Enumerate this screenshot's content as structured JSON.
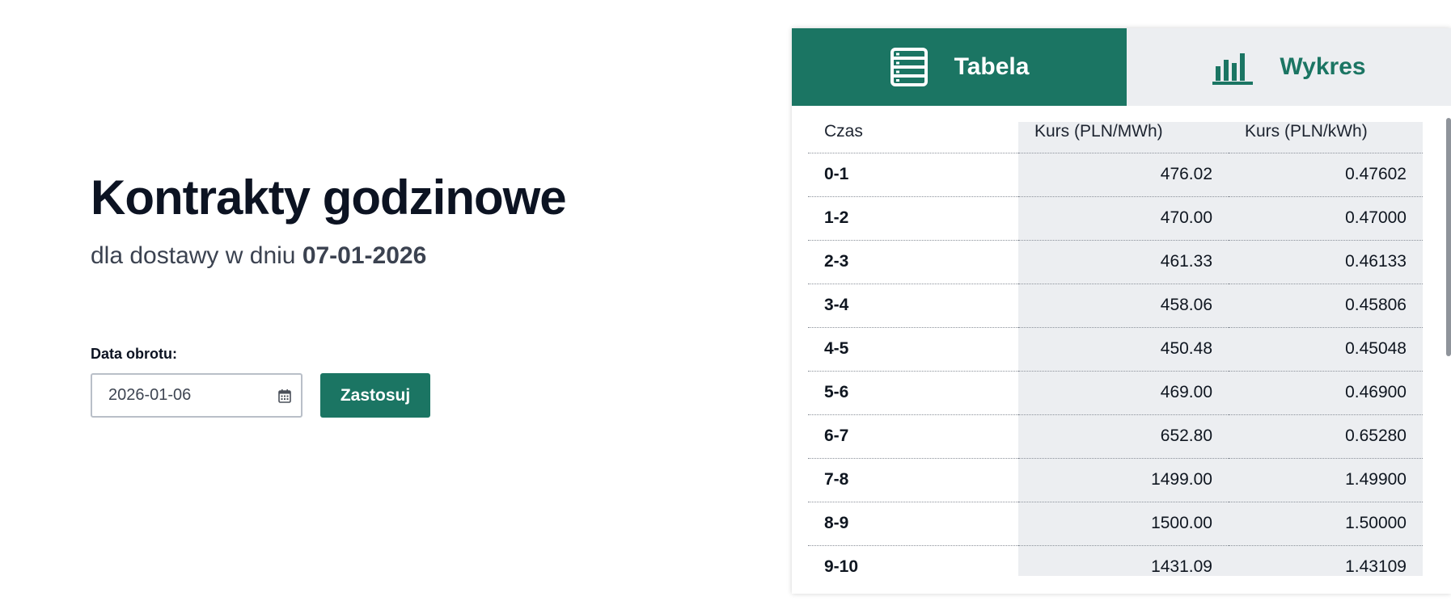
{
  "header": {
    "title": "Kontrakty godzinowe",
    "subtitle_prefix": "dla dostawy w dniu ",
    "subtitle_date": "07-01-2026"
  },
  "form": {
    "label": "Data obrotu:",
    "date_value": "2026-01-06",
    "apply_label": "Zastosuj",
    "accent": "#1b7563"
  },
  "tabs": [
    {
      "label": "Tabela",
      "icon": "table-icon",
      "active": true
    },
    {
      "label": "Wykres",
      "icon": "bar-chart-icon",
      "active": false
    }
  ],
  "table": {
    "columns": [
      "Czas",
      "Kurs (PLN/MWh)",
      "Kurs (PLN/kWh)"
    ],
    "rows": [
      [
        "0-1",
        "476.02",
        "0.47602"
      ],
      [
        "1-2",
        "470.00",
        "0.47000"
      ],
      [
        "2-3",
        "461.33",
        "0.46133"
      ],
      [
        "3-4",
        "458.06",
        "0.45806"
      ],
      [
        "4-5",
        "450.48",
        "0.45048"
      ],
      [
        "5-6",
        "469.00",
        "0.46900"
      ],
      [
        "6-7",
        "652.80",
        "0.65280"
      ],
      [
        "7-8",
        "1499.00",
        "1.49900"
      ],
      [
        "8-9",
        "1500.00",
        "1.50000"
      ],
      [
        "9-10",
        "1431.09",
        "1.43109"
      ]
    ]
  }
}
